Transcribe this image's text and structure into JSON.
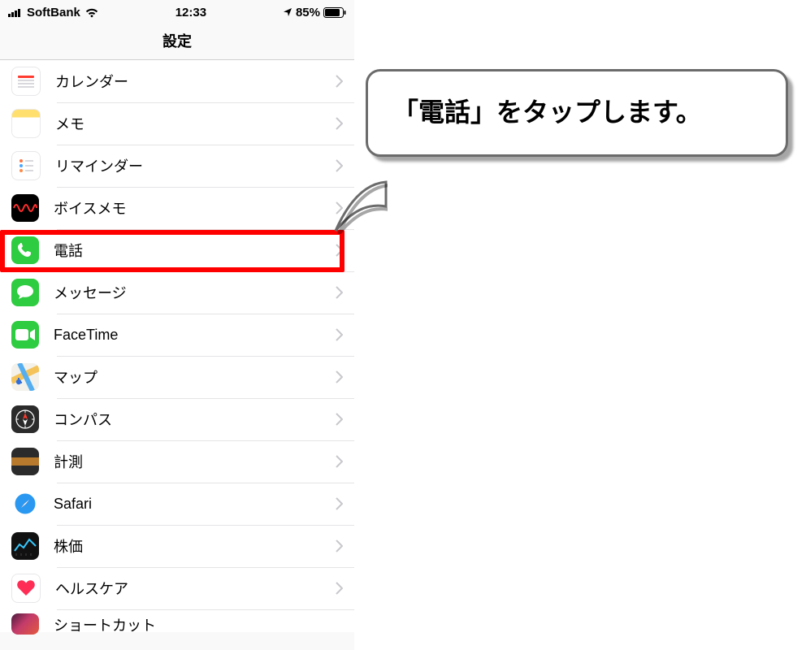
{
  "status": {
    "carrier": "SoftBank",
    "time": "12:33",
    "battery": "85%"
  },
  "header": {
    "title": "設定"
  },
  "rows": [
    {
      "id": "calendar",
      "label": "カレンダー"
    },
    {
      "id": "notes",
      "label": "メモ"
    },
    {
      "id": "reminders",
      "label": "リマインダー"
    },
    {
      "id": "voicememo",
      "label": "ボイスメモ"
    },
    {
      "id": "phone",
      "label": "電話"
    },
    {
      "id": "messages",
      "label": "メッセージ"
    },
    {
      "id": "facetime",
      "label": "FaceTime"
    },
    {
      "id": "maps",
      "label": "マップ"
    },
    {
      "id": "compass",
      "label": "コンパス"
    },
    {
      "id": "measure",
      "label": "計測"
    },
    {
      "id": "safari",
      "label": "Safari"
    },
    {
      "id": "stocks",
      "label": "株価"
    },
    {
      "id": "health",
      "label": "ヘルスケア"
    },
    {
      "id": "shortcuts",
      "label": "ショートカット"
    }
  ],
  "highlight_row": "phone",
  "callout": {
    "text": "「電話」をタップします。"
  }
}
